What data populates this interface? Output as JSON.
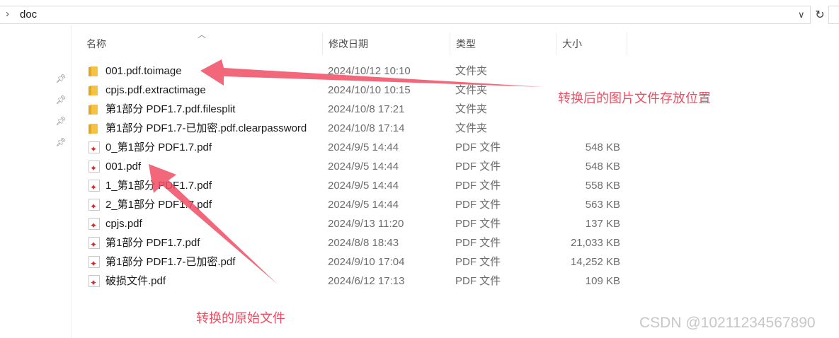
{
  "address": {
    "path": "doc"
  },
  "columns": {
    "name": "名称",
    "date": "修改日期",
    "type": "类型",
    "size": "大小"
  },
  "files": [
    {
      "name": "001.pdf.toimage",
      "date": "2024/10/12 10:10",
      "type": "文件夹",
      "size": "",
      "icon": "folder-icon"
    },
    {
      "name": "cpjs.pdf.extractimage",
      "date": "2024/10/10 10:15",
      "type": "文件夹",
      "size": "",
      "icon": "folder-icon"
    },
    {
      "name": "第1部分 PDF1.7.pdf.filesplit",
      "date": "2024/10/8 17:21",
      "type": "文件夹",
      "size": "",
      "icon": "folder-icon"
    },
    {
      "name": "第1部分 PDF1.7-已加密.pdf.clearpassword",
      "date": "2024/10/8 17:14",
      "type": "文件夹",
      "size": "",
      "icon": "folder-icon"
    },
    {
      "name": "0_第1部分 PDF1.7.pdf",
      "date": "2024/9/5 14:44",
      "type": "PDF 文件",
      "size": "548 KB",
      "icon": "pdf-icon"
    },
    {
      "name": "001.pdf",
      "date": "2024/9/5 14:44",
      "type": "PDF 文件",
      "size": "548 KB",
      "icon": "pdf-icon"
    },
    {
      "name": "1_第1部分 PDF1.7.pdf",
      "date": "2024/9/5 14:44",
      "type": "PDF 文件",
      "size": "558 KB",
      "icon": "pdf-icon"
    },
    {
      "name": "2_第1部分 PDF1.7.pdf",
      "date": "2024/9/5 14:44",
      "type": "PDF 文件",
      "size": "563 KB",
      "icon": "pdf-icon"
    },
    {
      "name": "cpjs.pdf",
      "date": "2024/9/13 11:20",
      "type": "PDF 文件",
      "size": "137 KB",
      "icon": "pdf-icon"
    },
    {
      "name": "第1部分 PDF1.7.pdf",
      "date": "2024/8/8 18:43",
      "type": "PDF 文件",
      "size": "21,033 KB",
      "icon": "pdf-icon"
    },
    {
      "name": "第1部分 PDF1.7-已加密.pdf",
      "date": "2024/9/10 17:04",
      "type": "PDF 文件",
      "size": "14,252 KB",
      "icon": "pdf-icon"
    },
    {
      "name": "破损文件.pdf",
      "date": "2024/6/12 17:13",
      "type": "PDF 文件",
      "size": "109 KB",
      "icon": "pdf-icon"
    }
  ],
  "annotations": {
    "output_location": "转换后的图片文件存放位置",
    "source_file": "转换的原始文件",
    "color": "#f04c61"
  },
  "watermark": "CSDN @10211234567890"
}
